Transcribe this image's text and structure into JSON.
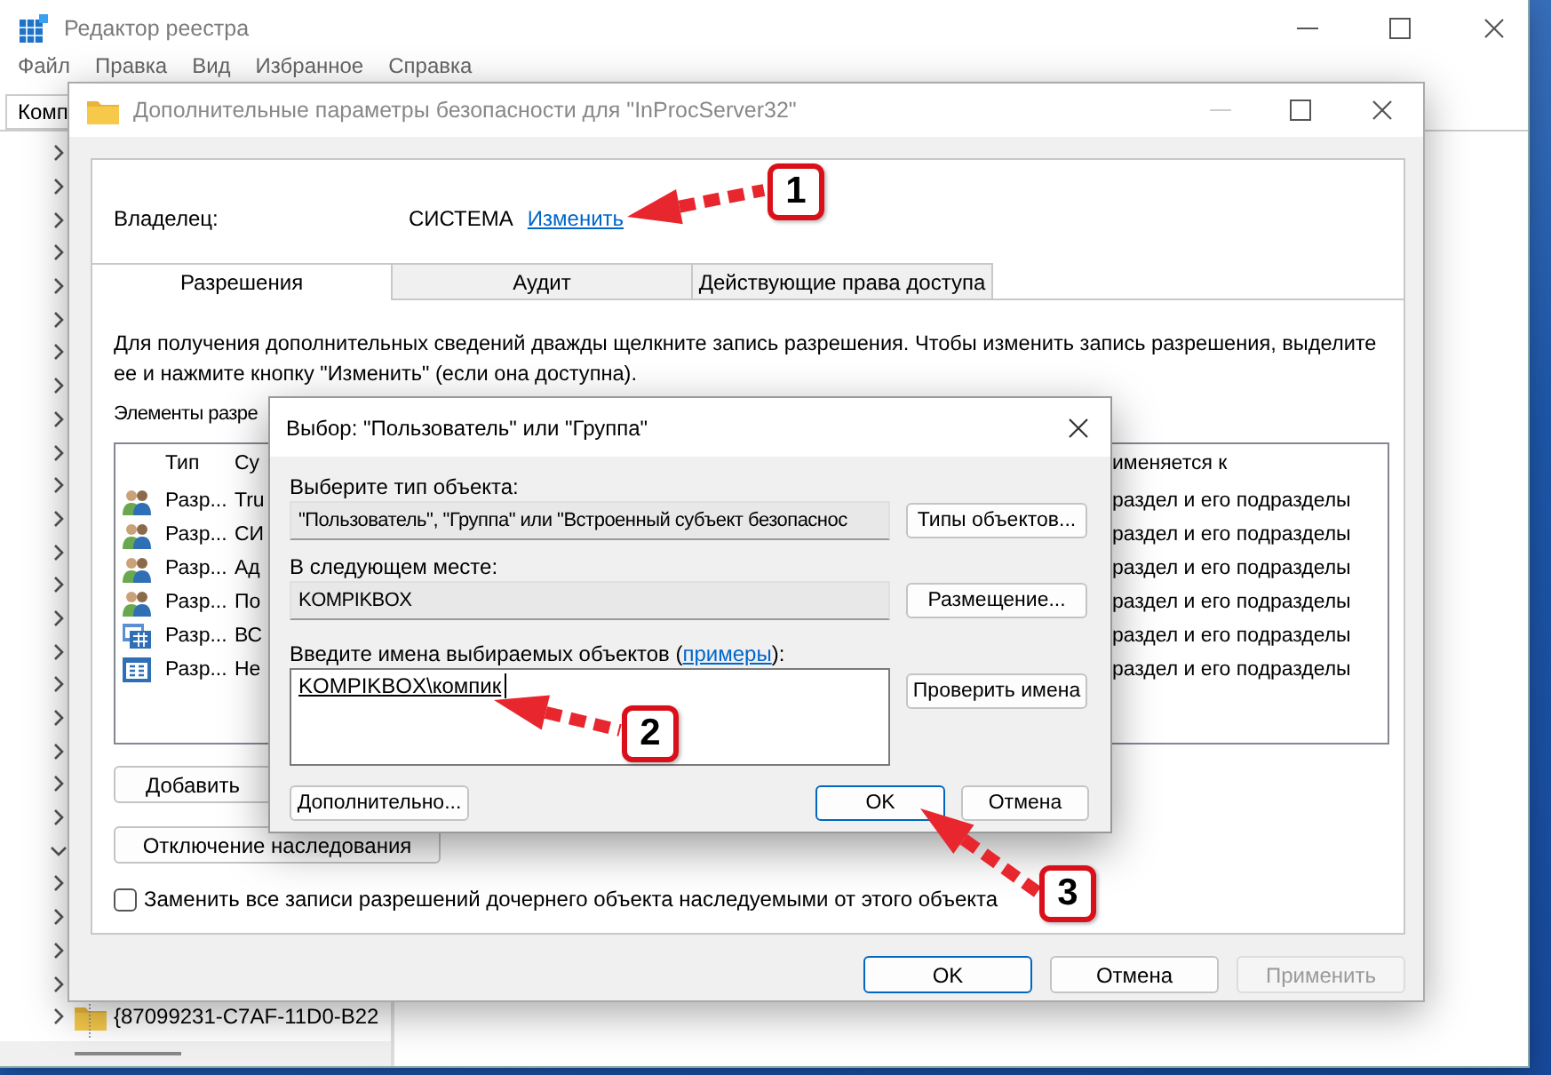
{
  "registry_editor": {
    "title": "Редактор реестра",
    "menu": [
      "Файл",
      "Правка",
      "Вид",
      "Избранное",
      "Справка"
    ],
    "address": "Комп",
    "tree": [
      {
        "expanded": false
      },
      {
        "expanded": false
      },
      {
        "expanded": false
      },
      {
        "expanded": false
      },
      {
        "expanded": false
      },
      {
        "expanded": false
      },
      {
        "expanded": false
      },
      {
        "expanded": false
      },
      {
        "expanded": false
      },
      {
        "expanded": false
      },
      {
        "expanded": false
      },
      {
        "expanded": false
      },
      {
        "expanded": false
      },
      {
        "expanded": false
      },
      {
        "expanded": false
      },
      {
        "expanded": false
      },
      {
        "expanded": false
      },
      {
        "expanded": false
      },
      {
        "expanded": false
      },
      {
        "expanded": false
      },
      {
        "expanded": false
      },
      {
        "expanded": true
      },
      {
        "expanded": false
      },
      {
        "expanded": false
      },
      {
        "expanded": false
      },
      {
        "expanded": false
      },
      {
        "expanded": false,
        "label": "{87099231-C7AF-11D0-B22"
      }
    ]
  },
  "security_dialog": {
    "title": "Дополнительные параметры безопасности  для \"InProcServer32\"",
    "owner_label": "Владелец:",
    "owner": "СИСТЕМА",
    "owner_link": "Изменить",
    "tabs": [
      {
        "label": "Разрешения",
        "selected": true
      },
      {
        "label": "Аудит",
        "selected": false
      },
      {
        "label": "Действующие права доступа",
        "selected": false
      }
    ],
    "description": "Для получения дополнительных сведений дважды щелкните запись разрешения. Чтобы изменить запись разрешения, выделите\nее и нажмите кнопку \"Изменить\" (если она доступна).",
    "list_label": "Элементы разре",
    "columns": [
      "Тип",
      "Су",
      "именяется к"
    ],
    "entries": [
      {
        "kind": "users",
        "type": "Разр...",
        "principal": "Tru",
        "applies_to": "раздел и его подразделы"
      },
      {
        "kind": "users",
        "type": "Разр...",
        "principal": "СИ",
        "applies_to": "раздел и его подразделы"
      },
      {
        "kind": "users",
        "type": "Разр...",
        "principal": "Ад",
        "applies_to": "раздел и его подразделы"
      },
      {
        "kind": "users",
        "type": "Разр...",
        "principal": "По",
        "applies_to": "раздел и его подразделы"
      },
      {
        "kind": "packages",
        "type": "Разр...",
        "principal": "ВС",
        "applies_to": "раздел и его подразделы"
      },
      {
        "kind": "app",
        "type": "Разр...",
        "principal": "Не",
        "applies_to": "раздел и его подразделы"
      }
    ],
    "buttons": [
      "Добавить",
      "Отключение наследования"
    ],
    "replace_checkbox": {
      "label": "Заменить все записи разрешений дочернего объекта наследуемыми от этого объекта",
      "checked": false
    },
    "footer_buttons": [
      {
        "label": "OK",
        "default": true,
        "disabled": false
      },
      {
        "label": "Отмена",
        "default": false,
        "disabled": false
      },
      {
        "label": "Применить",
        "default": false,
        "disabled": true
      }
    ]
  },
  "select_dialog": {
    "title": "Выбор: \"Пользователь\" или \"Группа\"",
    "object_type_label": "Выберите тип объекта:",
    "object_type": "\"Пользователь\", \"Группа\" или \"Встроенный субъект безопаснос",
    "object_types_button": "Типы объектов...",
    "location_label": "В следующем месте:",
    "location": "KOMPIKBOX",
    "location_button": "Размещение...",
    "names_label_before": "Введите имена выбираемых объектов (",
    "examples_link": "примеры",
    "names_label_after": "):",
    "names_value": "KOMPIKBOX\\компик",
    "check_names_button": "Проверить имена",
    "advanced_button": "Дополнительно...",
    "ok_button": "OK",
    "cancel_button": "Отмена"
  },
  "annotations": [
    {
      "number": "1"
    },
    {
      "number": "2"
    },
    {
      "number": "3"
    }
  ]
}
